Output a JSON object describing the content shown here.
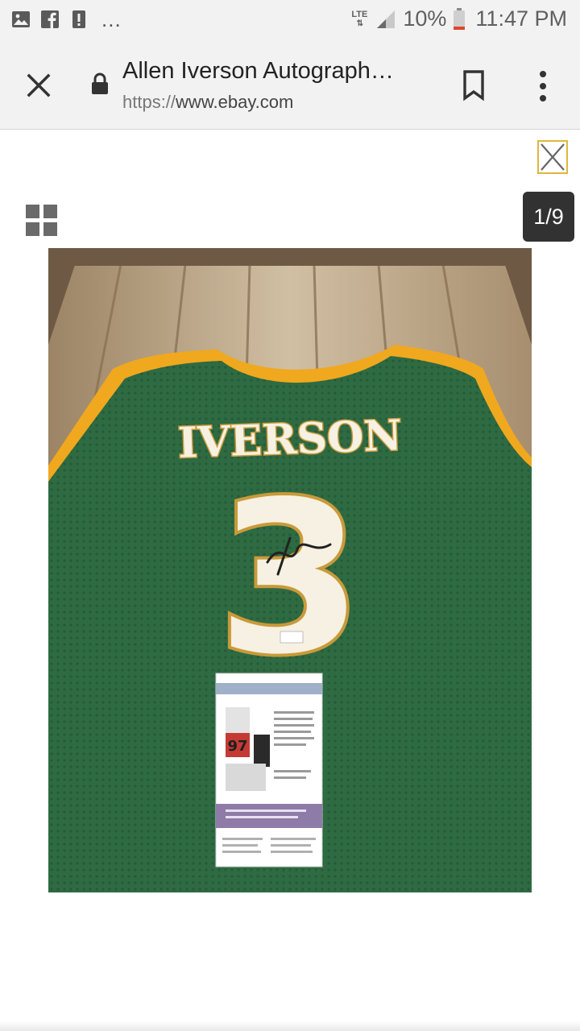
{
  "status_bar": {
    "left_icons": [
      "gallery-icon",
      "facebook-icon",
      "alert-icon"
    ],
    "more_indicator": "...",
    "network_type": "LTE",
    "signal_icon": "signal-icon",
    "battery_percent": "10%",
    "battery_icon": "battery-low-icon",
    "time": "11:47 PM"
  },
  "browser": {
    "close_icon": "close-icon",
    "secure_icon": "lock-icon",
    "page_title": "Allen Iverson Autograph…",
    "url_scheme": "https://",
    "url_host": "www.ebay.com",
    "bookmark_icon": "bookmark-icon",
    "menu_icon": "more-vert-icon"
  },
  "viewer": {
    "close_icon": "close-icon",
    "grid_icon": "grid-view-icon",
    "counter": "1/9",
    "image": {
      "jersey_name": "IVERSON",
      "jersey_number": "3",
      "tag_number_text": "97",
      "colors": {
        "jersey": "#2e6a42",
        "trim": "#f0a81e",
        "lettering": "#f6f1e2",
        "frame": "#bfa88a"
      }
    }
  }
}
